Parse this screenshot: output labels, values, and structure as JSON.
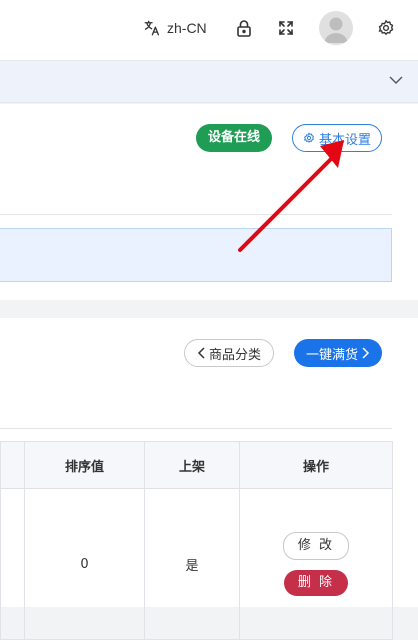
{
  "header": {
    "language_label": "zh-CN",
    "icons": [
      "translate-icon",
      "lock-icon",
      "fullscreen-icon",
      "avatar",
      "gear-icon"
    ]
  },
  "collapse": {
    "icon": "chevron-down-icon"
  },
  "device": {
    "status_label": "设备在线",
    "status_color": "#1f9d55",
    "settings_label": "基本设置"
  },
  "toolbar": {
    "category_label": "商品分类",
    "restock_label": "一键满货",
    "accent": "#1a73e8"
  },
  "table": {
    "columns": [
      "排序值",
      "上架",
      "操作"
    ],
    "rows": [
      {
        "sort": "0",
        "listed": "是",
        "edit_label": "修 改",
        "delete_label": "删 除"
      }
    ]
  },
  "annotation": {
    "arrow_color": "#e30613"
  }
}
